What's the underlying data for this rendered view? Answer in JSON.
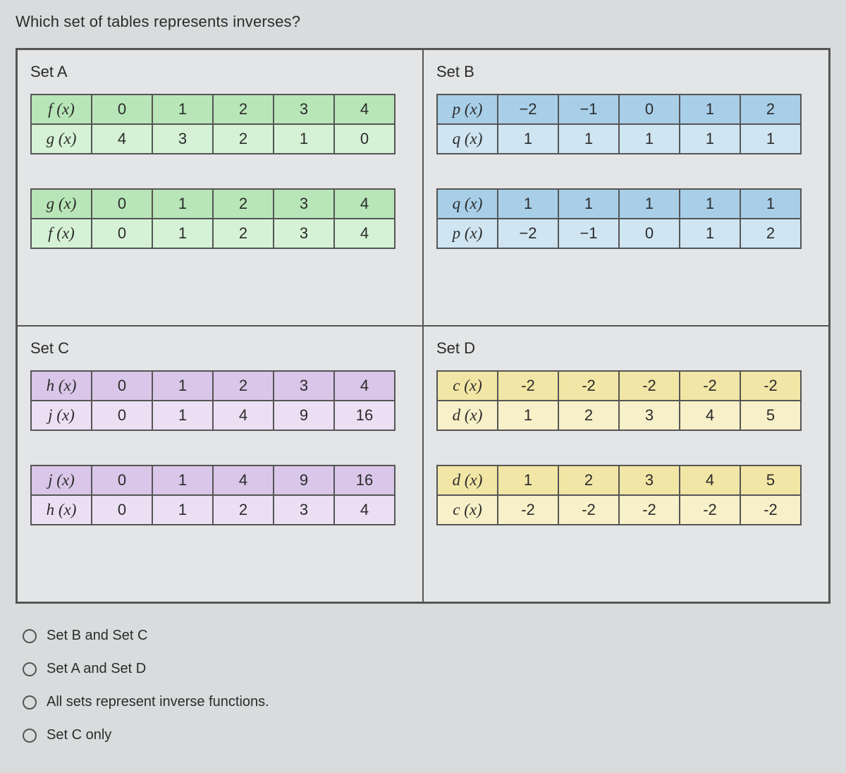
{
  "question": "Which set of tables represents inverses?",
  "sets": {
    "A": {
      "label": "Set A",
      "t1": {
        "f": "f (x)",
        "g": "g (x)",
        "r1": [
          "0",
          "1",
          "2",
          "3",
          "4"
        ],
        "r2": [
          "4",
          "3",
          "2",
          "1",
          "0"
        ]
      },
      "t2": {
        "f": "g (x)",
        "g": "f (x)",
        "r1": [
          "0",
          "1",
          "2",
          "3",
          "4"
        ],
        "r2": [
          "0",
          "1",
          "2",
          "3",
          "4"
        ]
      }
    },
    "B": {
      "label": "Set B",
      "t1": {
        "f": "p (x)",
        "g": "q (x)",
        "r1": [
          "−2",
          "−1",
          "0",
          "1",
          "2"
        ],
        "r2": [
          "1",
          "1",
          "1",
          "1",
          "1"
        ]
      },
      "t2": {
        "f": "q (x)",
        "g": "p (x)",
        "r1": [
          "1",
          "1",
          "1",
          "1",
          "1"
        ],
        "r2": [
          "−2",
          "−1",
          "0",
          "1",
          "2"
        ]
      }
    },
    "C": {
      "label": "Set C",
      "t1": {
        "f": "h (x)",
        "g": "j (x)",
        "r1": [
          "0",
          "1",
          "2",
          "3",
          "4"
        ],
        "r2": [
          "0",
          "1",
          "4",
          "9",
          "16"
        ]
      },
      "t2": {
        "f": "j (x)",
        "g": "h (x)",
        "r1": [
          "0",
          "1",
          "4",
          "9",
          "16"
        ],
        "r2": [
          "0",
          "1",
          "2",
          "3",
          "4"
        ]
      }
    },
    "D": {
      "label": "Set D",
      "t1": {
        "f": "c (x)",
        "g": "d (x)",
        "r1": [
          "-2",
          "-2",
          "-2",
          "-2",
          "-2"
        ],
        "r2": [
          "1",
          "2",
          "3",
          "4",
          "5"
        ]
      },
      "t2": {
        "f": "d (x)",
        "g": "c (x)",
        "r1": [
          "1",
          "2",
          "3",
          "4",
          "5"
        ],
        "r2": [
          "-2",
          "-2",
          "-2",
          "-2",
          "-2"
        ]
      }
    }
  },
  "options": [
    "Set B and Set C",
    "Set A and Set D",
    "All sets represent inverse functions.",
    "Set C only"
  ]
}
